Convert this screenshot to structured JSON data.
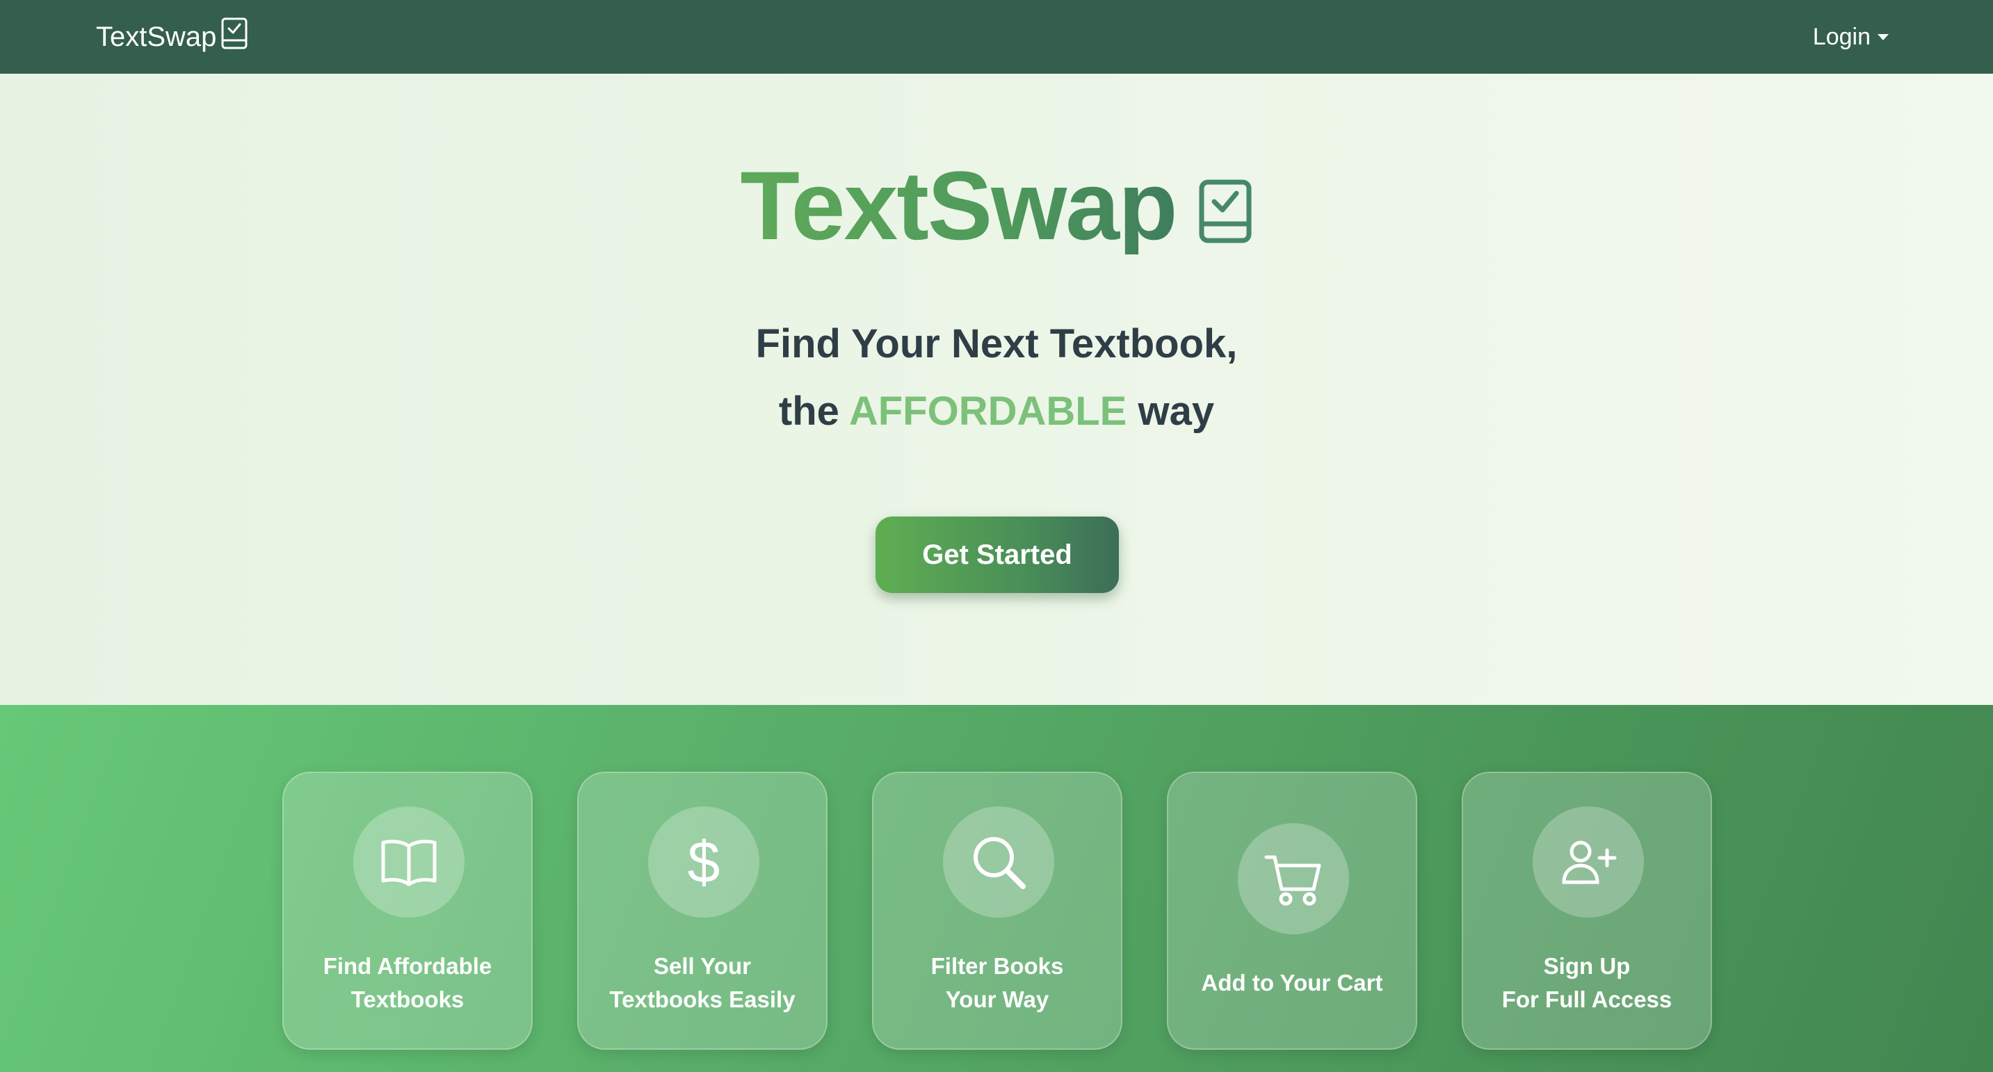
{
  "navbar": {
    "brand": "TextSwap",
    "brand_icon": "book-check-icon",
    "login_label": "Login"
  },
  "hero": {
    "title": "TextSwap",
    "title_icon": "book-check-icon",
    "tagline_line1": "Find Your Next Textbook,",
    "tagline_the": "the",
    "tagline_accent": "AFFORDABLE",
    "tagline_way": "way",
    "cta_label": "Get Started"
  },
  "features": [
    {
      "icon": "open-book-icon",
      "line1": "Find Affordable",
      "line2": "Textbooks"
    },
    {
      "icon": "dollar-icon",
      "glyph": "$",
      "line1": "Sell Your",
      "line2": "Textbooks Easily"
    },
    {
      "icon": "search-icon",
      "line1": "Filter Books",
      "line2": "Your Way"
    },
    {
      "icon": "cart-icon",
      "line1": "Add to Your Cart"
    },
    {
      "icon": "person-add-icon",
      "line1": "Sign Up",
      "line2": "For Full Access"
    }
  ],
  "colors": {
    "navbar": "#335f4c",
    "accent": "#7cc17a",
    "title_green": "#5fa95a",
    "text_dark": "#2f3e46"
  }
}
